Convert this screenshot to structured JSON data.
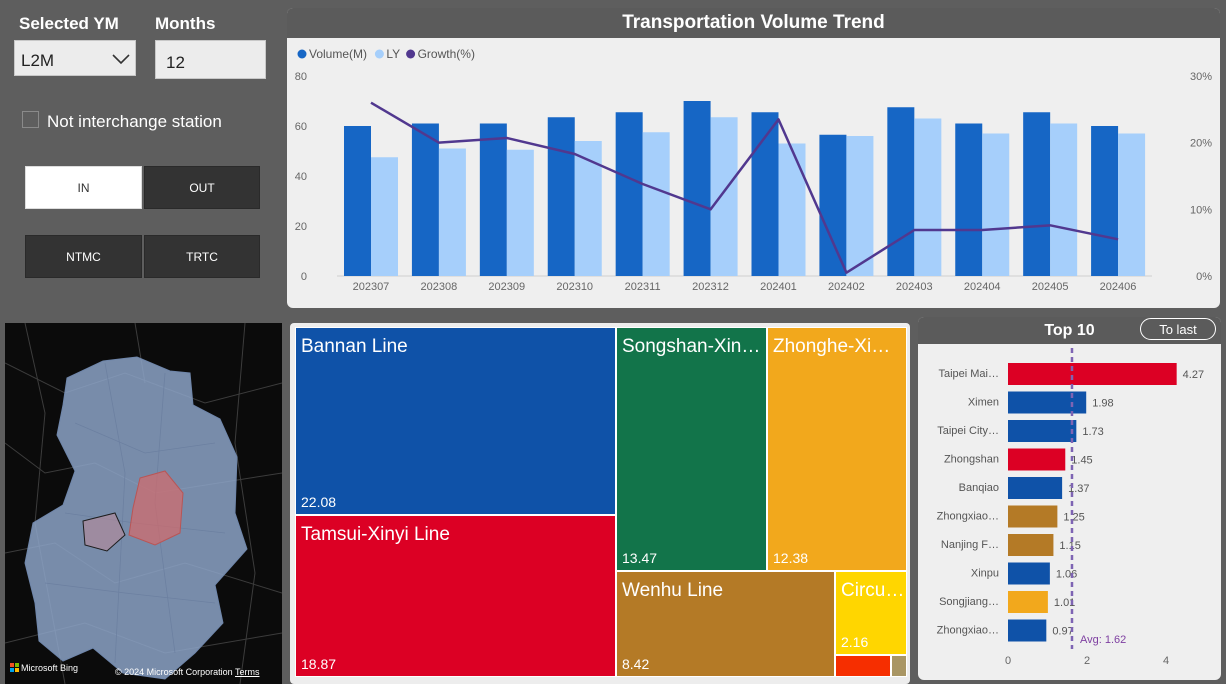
{
  "filters": {
    "selected_ym_label": "Selected YM",
    "selected_ym_value": "L2M",
    "months_label": "Months",
    "months_value": "12",
    "checkbox_label": "Not interchange station",
    "buttons": {
      "in": "IN",
      "out": "OUT",
      "ntmc": "NTMC",
      "trtc": "TRTC"
    }
  },
  "trend": {
    "title": "Transportation Volume Trend",
    "legend": [
      "Volume(M)",
      "LY",
      "Growth(%)"
    ],
    "colors": {
      "volume": "#1666c5",
      "ly": "#a6cffb",
      "growth": "#51388f"
    },
    "y_ticks": [
      "80",
      "60",
      "40",
      "20",
      "0"
    ],
    "y2_ticks": [
      "30%",
      "20%",
      "10%",
      "0%"
    ]
  },
  "map": {
    "bing_label": "Microsoft Bing",
    "copyright": "© 2024 Microsoft Corporation",
    "terms": "Terms"
  },
  "treemap": {
    "items": [
      {
        "name": "Bannan Line",
        "value": "22.08",
        "color": "#0f52a8"
      },
      {
        "name": "Tamsui-Xinyi Line",
        "value": "18.87",
        "color": "#dc0024"
      },
      {
        "name": "Songshan-Xin…",
        "value": "13.47",
        "color": "#12744a"
      },
      {
        "name": "Zhonghe-Xi…",
        "value": "12.38",
        "color": "#f2a81c"
      },
      {
        "name": "Wenhu Line",
        "value": "8.42",
        "color": "#b47a26"
      },
      {
        "name": "Circu…",
        "value": "2.16",
        "color": "#ffd600"
      }
    ],
    "small_colors": [
      "#f62e00",
      "#a99664"
    ]
  },
  "top10": {
    "title": "Top 10",
    "toggle": "To last",
    "avg_label": "Avg: 1.62",
    "avg": 1.62,
    "x_ticks": [
      "0",
      "2",
      "4"
    ],
    "bars": [
      {
        "name": "Taipei Mai…",
        "value": 4.27,
        "label": "4.27",
        "color": "#dc0024"
      },
      {
        "name": "Ximen",
        "value": 1.98,
        "label": "1.98",
        "color": "#0f52a8"
      },
      {
        "name": "Taipei City…",
        "value": 1.73,
        "label": "1.73",
        "color": "#0f52a8"
      },
      {
        "name": "Zhongshan",
        "value": 1.45,
        "label": "1.45",
        "color": "#dc0024"
      },
      {
        "name": "Banqiao",
        "value": 1.37,
        "label": "1.37",
        "color": "#0f52a8"
      },
      {
        "name": "Zhongxiao…",
        "value": 1.25,
        "label": "1.25",
        "color": "#b47a26"
      },
      {
        "name": "Nanjing F…",
        "value": 1.15,
        "label": "1.15",
        "color": "#b47a26"
      },
      {
        "name": "Xinpu",
        "value": 1.06,
        "label": "1.06",
        "color": "#0f52a8"
      },
      {
        "name": "Songjiang…",
        "value": 1.01,
        "label": "1.01",
        "color": "#f2a81c"
      },
      {
        "name": "Zhongxiao…",
        "value": 0.97,
        "label": "0.97",
        "color": "#0f52a8"
      }
    ]
  },
  "chart_data": [
    {
      "type": "bar",
      "title": "Transportation Volume Trend",
      "categories": [
        "202307",
        "202308",
        "202309",
        "202310",
        "202311",
        "202312",
        "202401",
        "202402",
        "202403",
        "202404",
        "202405",
        "202406"
      ],
      "series": [
        {
          "name": "Volume(M)",
          "values": [
            60,
            61,
            61,
            63.5,
            65.5,
            70,
            65.5,
            56.5,
            67.5,
            61,
            65.5,
            60
          ]
        },
        {
          "name": "LY",
          "values": [
            47.5,
            51,
            50.5,
            54,
            57.5,
            63.5,
            53,
            56,
            63,
            57,
            61,
            57
          ]
        },
        {
          "name": "Growth(%)",
          "type": "line",
          "axis": "right",
          "values": [
            26,
            20,
            20.7,
            18.3,
            13.8,
            10,
            23.5,
            0.5,
            6.9,
            6.9,
            7.6,
            5.5
          ]
        }
      ],
      "ylim": [
        0,
        80
      ],
      "y2lim": [
        0,
        30
      ]
    },
    {
      "type": "bar",
      "title": "Top 10",
      "orientation": "horizontal",
      "categories": [
        "Taipei Mai…",
        "Ximen",
        "Taipei City…",
        "Zhongshan",
        "Banqiao",
        "Zhongxiao…",
        "Nanjing F…",
        "Xinpu",
        "Songjiang…",
        "Zhongxiao…"
      ],
      "values": [
        4.27,
        1.98,
        1.73,
        1.45,
        1.37,
        1.25,
        1.15,
        1.06,
        1.01,
        0.97
      ],
      "xlim": [
        0,
        4.5
      ]
    }
  ]
}
